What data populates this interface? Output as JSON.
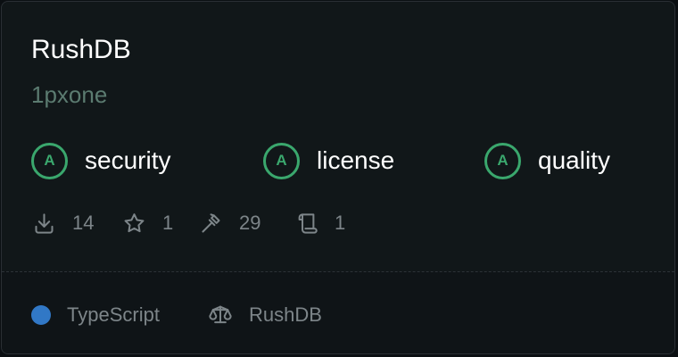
{
  "package": {
    "name": "RushDB",
    "owner": "1pxone"
  },
  "grades": [
    {
      "badge": "A",
      "label": "security",
      "icon": "grade-circle-icon",
      "color": "#3aa76d"
    },
    {
      "badge": "A",
      "label": "license",
      "icon": "grade-circle-icon",
      "color": "#3aa76d"
    },
    {
      "badge": "A",
      "label": "quality",
      "icon": "grade-circle-icon",
      "color": "#3aa76d"
    }
  ],
  "stats": [
    {
      "icon": "download-icon",
      "value": "14"
    },
    {
      "icon": "star-icon",
      "value": "1"
    },
    {
      "icon": "hammer-icon",
      "value": "29"
    },
    {
      "icon": "scroll-icon",
      "value": "1"
    }
  ],
  "footer": {
    "language": "TypeScript",
    "language_color": "#3178c6",
    "license": "RushDB",
    "license_icon": "scale-icon"
  }
}
